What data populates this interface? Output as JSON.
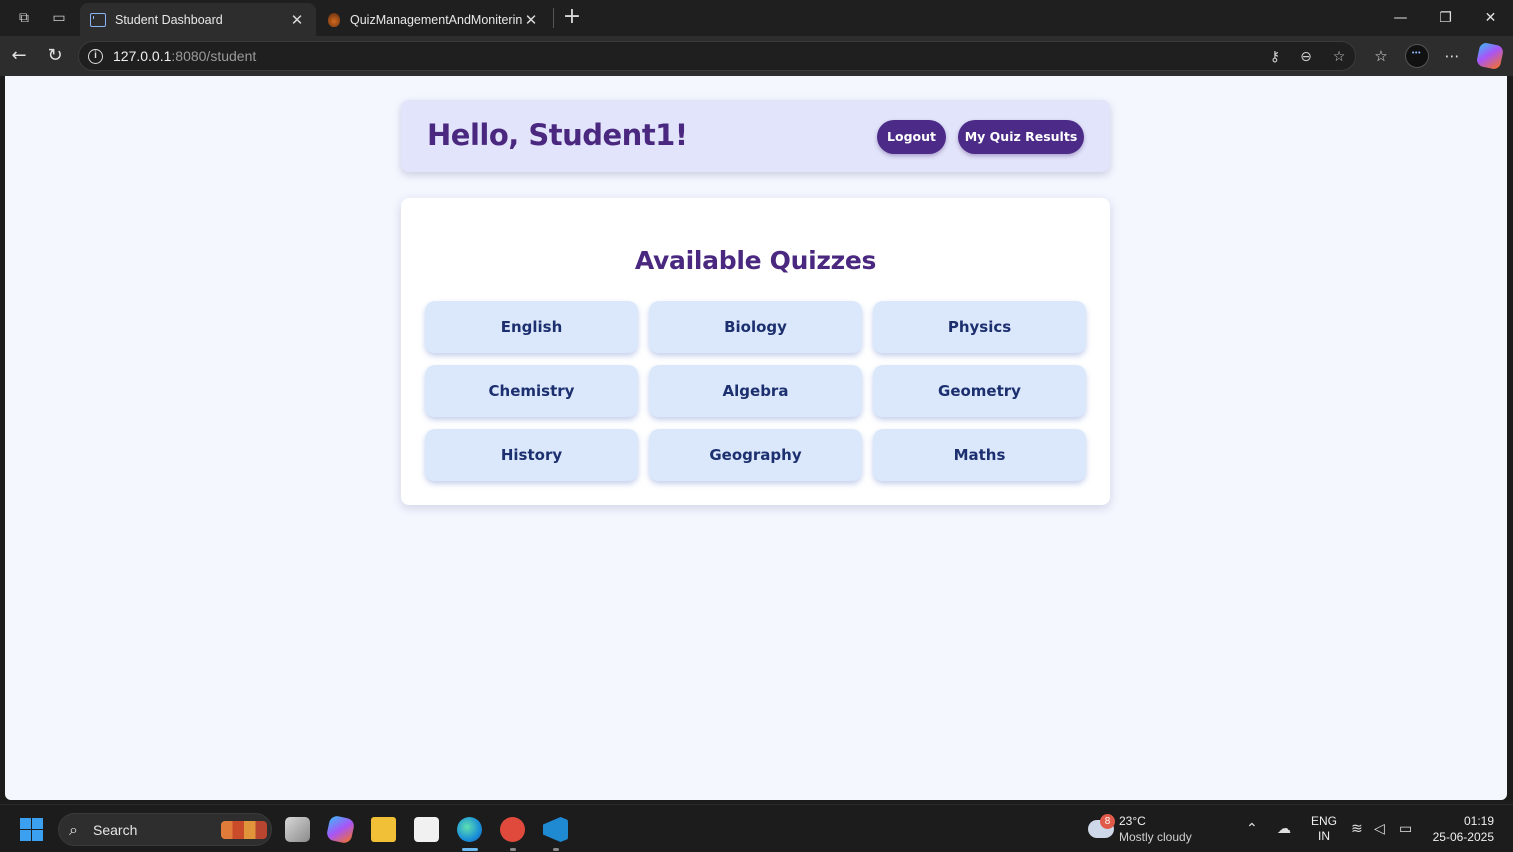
{
  "browser": {
    "tabs": [
      {
        "label": "Student Dashboard",
        "active": true
      },
      {
        "label": "QuizManagementAndMonitering",
        "active": false
      }
    ],
    "new_tab_label": "+",
    "url_host": "127.0.0.1",
    "url_rest": ":8080/student"
  },
  "header": {
    "greeting": "Hello, Student1!",
    "logout_label": "Logout",
    "results_label": "My Quiz Results"
  },
  "quizzes": {
    "title": "Available Quizzes",
    "items": [
      "English",
      "Biology",
      "Physics",
      "Chemistry",
      "Algebra",
      "Geometry",
      "History",
      "Geography",
      "Maths"
    ]
  },
  "colors": {
    "accent": "#4c2a88",
    "header_bg": "#e2e4fb",
    "tile_bg": "#dbe8fc",
    "tile_text": "#1c2f6e",
    "page_bg": "#f4f7fe"
  },
  "taskbar": {
    "search_label": "Search",
    "weather_badge": "8",
    "weather_temp": "23°C",
    "weather_condition": "Mostly cloudy",
    "lang_top": "ENG",
    "lang_bottom": "IN",
    "time": "01:19",
    "date": "25-06-2025"
  }
}
